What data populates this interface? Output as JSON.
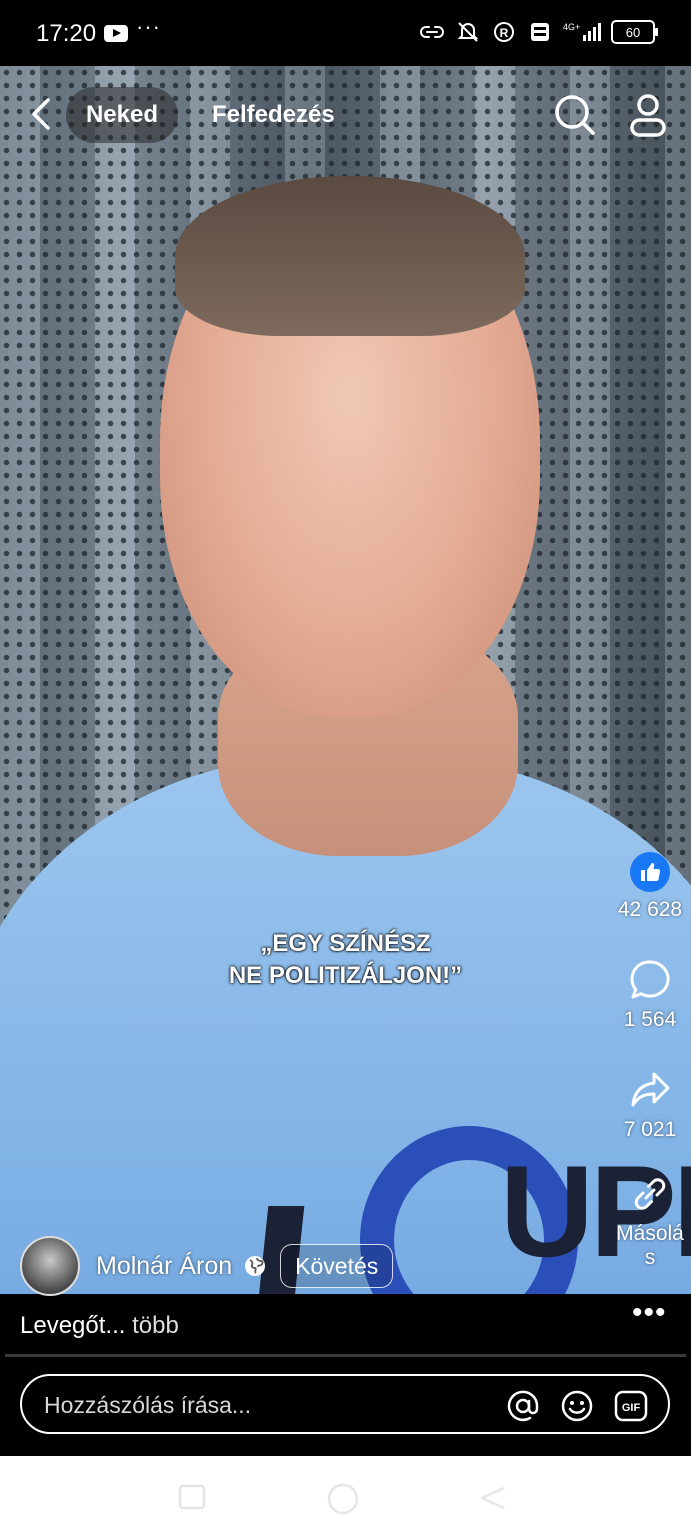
{
  "status_bar": {
    "time": "17:20",
    "more": "···",
    "network": "4G+",
    "battery": "60"
  },
  "top_nav": {
    "active_tab": "Neked",
    "tab_explore": "Felfedezés"
  },
  "video": {
    "caption_line1": "„EGY SZÍNÉSZ",
    "caption_line2": "NE POLITIZÁLJON!”",
    "shirt_text": "UPE"
  },
  "actions": {
    "likes": "42 628",
    "comments": "1 564",
    "shares": "7 021",
    "copy_label_1": "Másolá",
    "copy_label_2": "s"
  },
  "author": {
    "name": "Molnár Áron",
    "follow_label": "Követés"
  },
  "description": {
    "text": "Levegőt...",
    "more": "több"
  },
  "comment_box": {
    "placeholder": "Hozzászólás írása...",
    "gif_label": "GIF"
  },
  "colors": {
    "like_blue": "#1877f2",
    "background": "#000000"
  }
}
